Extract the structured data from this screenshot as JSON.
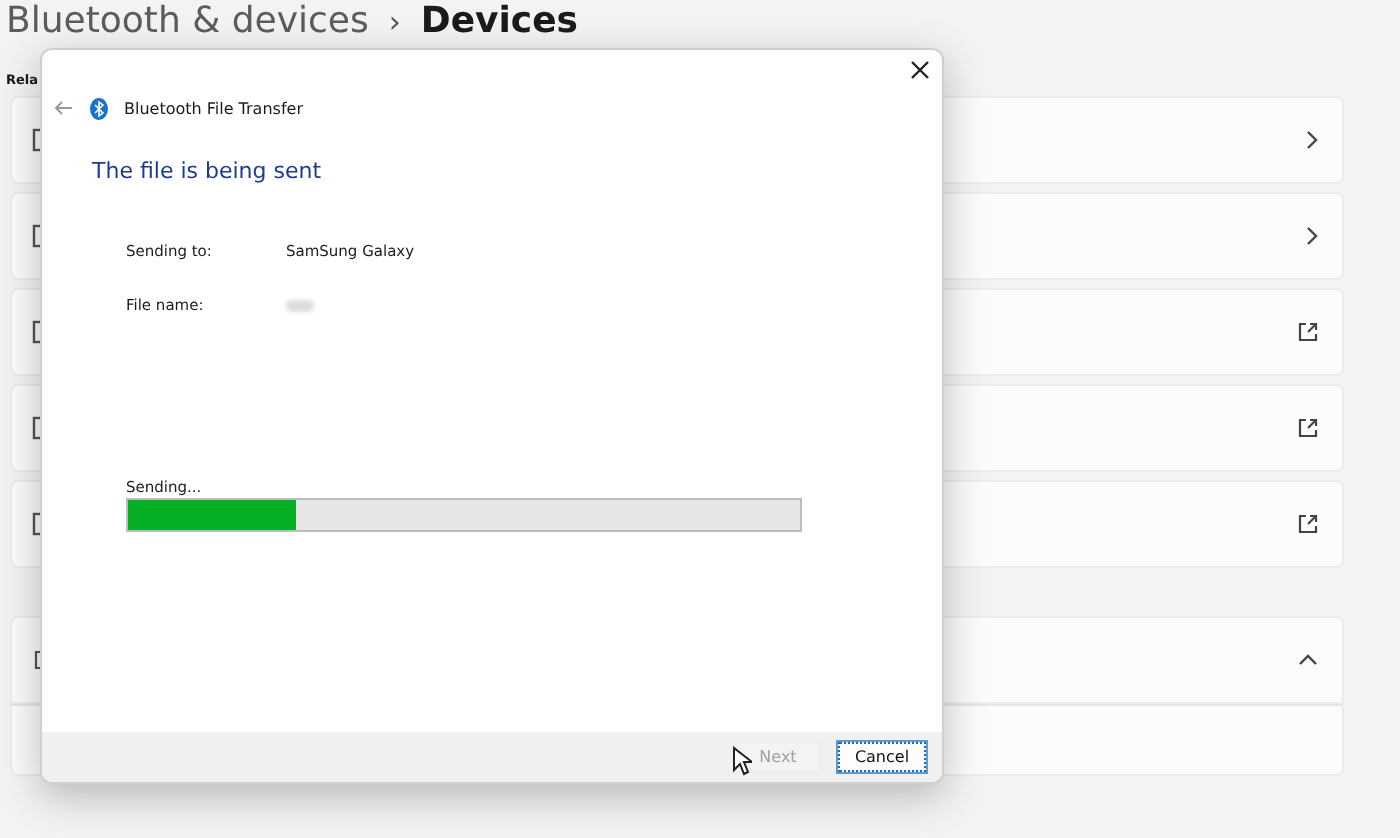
{
  "settings": {
    "breadcrumb_parent": "Bluetooth & devices",
    "breadcrumb_separator": "›",
    "page_title": "Devices",
    "section_label": "Rela",
    "cards": [
      {
        "kind": "chevron"
      },
      {
        "kind": "chevron"
      },
      {
        "kind": "external"
      },
      {
        "kind": "external"
      },
      {
        "kind": "external"
      }
    ],
    "expander": {
      "expanded": true
    }
  },
  "dialog": {
    "title": "Bluetooth File Transfer",
    "heading": "The file is being sent",
    "fields": [
      {
        "kind": "text",
        "label": "Sending to:",
        "value": "SamSung Galaxy"
      },
      {
        "kind": "blurred",
        "label": "File name:"
      }
    ],
    "progress": {
      "label": "Sending...",
      "level": 0.25
    },
    "buttons": [
      {
        "label": "Next",
        "disabled": true,
        "focused": false
      },
      {
        "label": "Cancel",
        "disabled": false,
        "focused": true
      }
    ]
  }
}
